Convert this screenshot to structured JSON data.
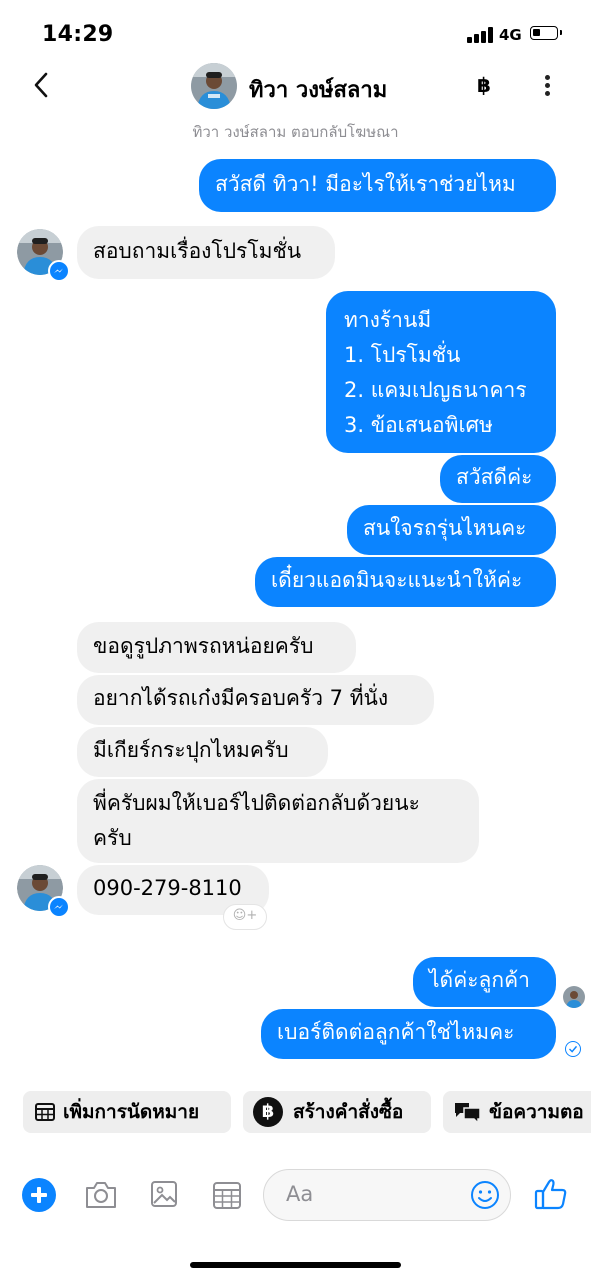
{
  "status_bar": {
    "time": "14:29",
    "network": "4G"
  },
  "header": {
    "name": "ทิวา วงษ์สลาม",
    "subtitle": "ทิวา วงษ์สลาม ตอบกลับโฆษณา",
    "baht_icon": "฿"
  },
  "messages": {
    "m1": "สวัสดี ทิวา! มีอะไรให้เราช่วยไหม",
    "m2": "สอบถามเรื่องโปรโมชั่น",
    "m3": [
      "ทางร้านมี",
      "1. โปรโมชั่น",
      "2. แคมเปญธนาคาร",
      "3. ข้อเสนอพิเศษ"
    ],
    "m4": "สวัสดีค่ะ",
    "m5": "สนใจรถรุ่นไหนคะ",
    "m6": "เดี๋ยวแอดมินจะแนะนำให้ค่ะ",
    "m7": "ขอดูรูปภาพรถหน่อยครับ",
    "m8": "อยากได้รถเก๋งมีครอบครัว 7 ที่นั่ง",
    "m9": "มีเกียร์กระปุกไหมครับ",
    "m10": [
      "พี่ครับผมให้เบอร์ไปติดต่อกลับด้วยนะ",
      "ครับ"
    ],
    "m11": "090-279-8110",
    "m12": "ได้ค่ะลูกค้า",
    "m13": "เบอร์ติดต่อลูกค้าใช่ไหมคะ"
  },
  "quick_replies": {
    "appointment": "เพิ่มการนัดหมาย",
    "order_icon": "฿",
    "order": "สร้างคำสั่งซื้อ",
    "auto_reply": "ข้อความตอ"
  },
  "composer": {
    "placeholder": "Aa"
  },
  "colors": {
    "accent": "#0b84ff",
    "incoming": "#f0f0f0",
    "muted": "#8e8e93"
  },
  "icons": [
    "back-icon",
    "baht-icon",
    "more-icon",
    "messenger-badge-icon",
    "add-reaction-icon",
    "calendar-icon",
    "baht-circle-icon",
    "chat-bubbles-icon",
    "plus-icon",
    "camera-icon",
    "image-icon",
    "calendar-grid-icon",
    "emoji-icon",
    "thumbs-up-icon"
  ]
}
